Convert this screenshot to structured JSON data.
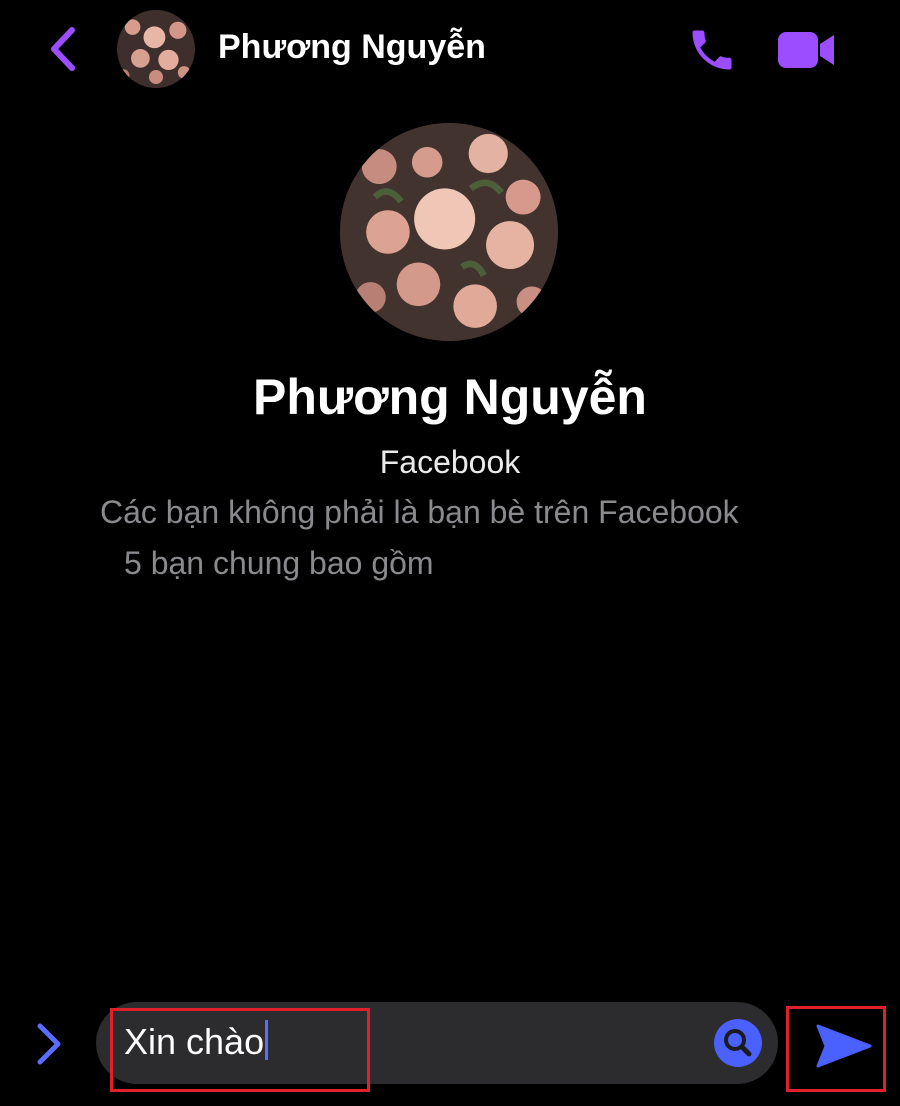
{
  "header": {
    "contact_name": "Phương Nguyễn",
    "back_icon": "chevron-left-icon",
    "call_icon": "phone-icon",
    "video_icon": "video-camera-icon"
  },
  "profile": {
    "name": "Phương Nguyễn",
    "platform": "Facebook",
    "friend_status": "Các bạn không phải là bạn bè trên Facebook",
    "mutual_friends": "5 bạn chung bao gồm"
  },
  "composer": {
    "message_text": "Xin chào",
    "expand_icon": "chevron-right-icon",
    "emoji_icon": "search-icon",
    "send_icon": "send-icon"
  },
  "colors": {
    "accent": "#9b4dff",
    "send": "#4a61ff",
    "highlight": "#e0202a",
    "background": "#000000"
  }
}
